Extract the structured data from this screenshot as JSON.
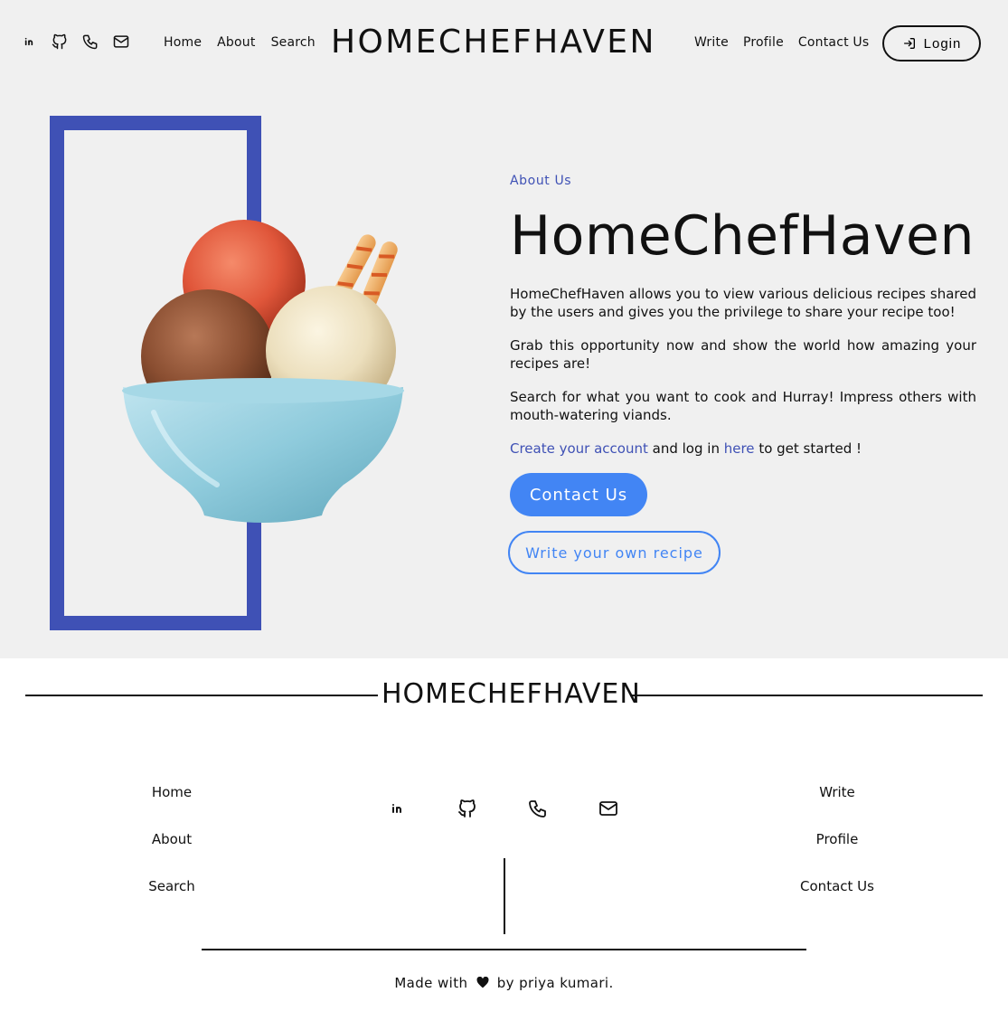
{
  "header": {
    "brand": "HOMECHEFHAVEN",
    "social_icons": [
      "linkedin-icon",
      "github-icon",
      "phone-icon",
      "mail-icon"
    ],
    "nav_left": [
      {
        "label": "Home"
      },
      {
        "label": "About"
      },
      {
        "label": "Search"
      }
    ],
    "nav_right": [
      {
        "label": "Write"
      },
      {
        "label": "Profile"
      },
      {
        "label": "Contact Us"
      }
    ],
    "login_label": "Login"
  },
  "hero": {
    "eyebrow": "About Us",
    "title": "HomeChefHaven",
    "paragraph_1": "HomeChefHaven allows you to view various delicious recipes shared by the users and gives you the privilege to share your recipe too!",
    "paragraph_2": "Grab this opportunity now and show the world how amazing your recipes are!",
    "paragraph_3": "Search for what you want to cook and Hurray! Impress others with mouth-watering viands.",
    "cta_link_1": "Create your account",
    "cta_middle": "and log in",
    "cta_link_2": "here",
    "cta_end": "to get started !",
    "contact_button": "Contact Us",
    "write_button": "Write your own recipe",
    "image": "ice-cream-bowl"
  },
  "footer": {
    "brand": "HOMECHEFHAVEN",
    "left_links": [
      {
        "label": "Home"
      },
      {
        "label": "About"
      },
      {
        "label": "Search"
      }
    ],
    "right_links": [
      {
        "label": "Write"
      },
      {
        "label": "Profile"
      },
      {
        "label": "Contact Us"
      }
    ],
    "social_icons": [
      "linkedin-icon",
      "github-icon",
      "phone-icon",
      "mail-icon"
    ],
    "made_prefix": "Made with",
    "made_suffix": "by priya kumari."
  },
  "colors": {
    "accent_blue": "#3f51b5",
    "button_blue": "#4285f4",
    "band_bg": "#f0f0f0"
  }
}
